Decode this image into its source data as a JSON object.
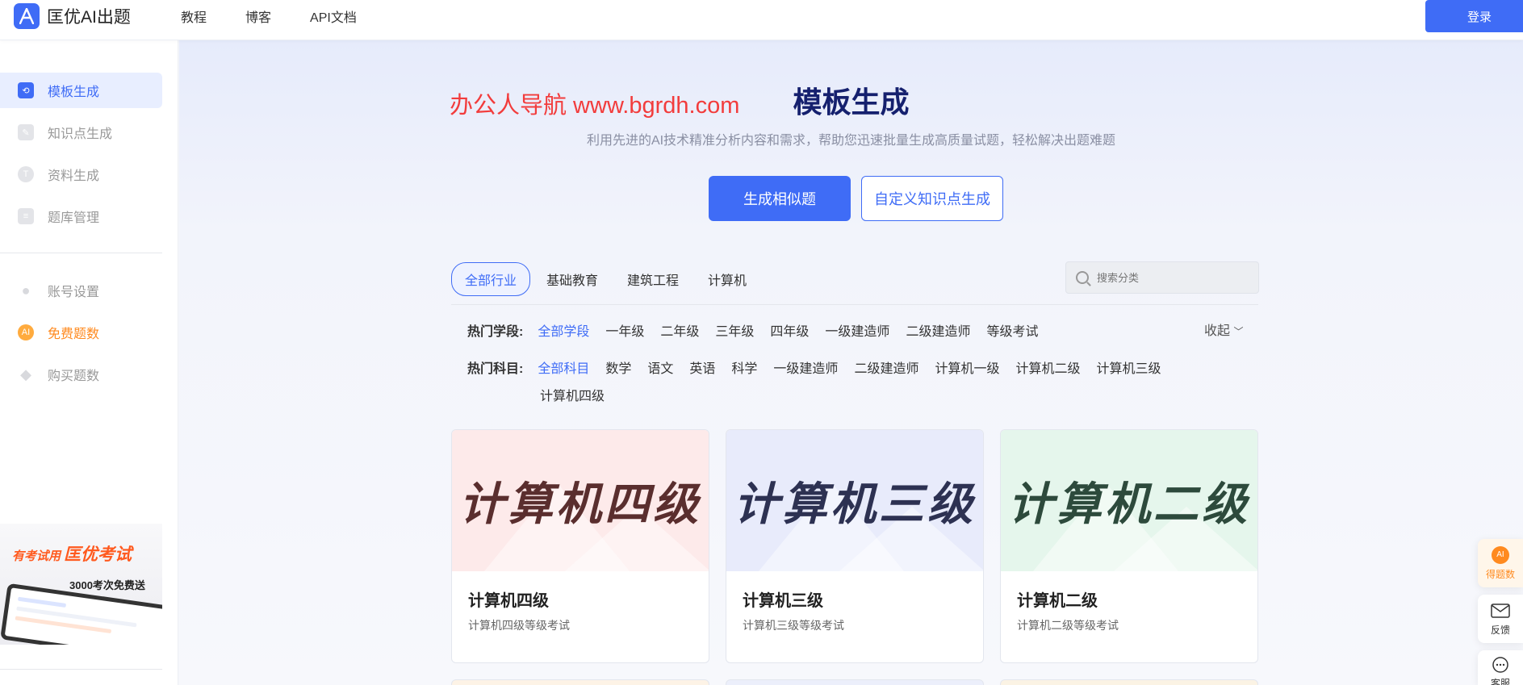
{
  "header": {
    "brand": "匡优AI出题",
    "nav": [
      "教程",
      "博客",
      "API文档"
    ],
    "login_label": "登录"
  },
  "sidebar": {
    "items": [
      {
        "label": "模板生成",
        "icon": "template-icon"
      },
      {
        "label": "知识点生成",
        "icon": "edit-icon"
      },
      {
        "label": "资料生成",
        "icon": "text-icon"
      },
      {
        "label": "题库管理",
        "icon": "database-icon"
      },
      {
        "label": "账号设置",
        "icon": "user-icon"
      },
      {
        "label": "免费题数",
        "icon": "ai-coin-icon"
      },
      {
        "label": "购买题数",
        "icon": "diamond-icon"
      }
    ],
    "promo": {
      "prefix": "有考试用",
      "brand": "匡优考试",
      "sub": "3000考次免费送"
    }
  },
  "main": {
    "watermark": "办公人导航 www.bgrdh.com",
    "title": "模板生成",
    "subtitle": "利用先进的AI技术精准分析内容和需求，帮助您迅速批量生成高质量试题，轻松解决出题难题",
    "btn_similar": "生成相似题",
    "btn_custom": "自定义知识点生成",
    "industry_tabs": [
      "全部行业",
      "基础教育",
      "建筑工程",
      "计算机"
    ],
    "search_placeholder": "搜索分类",
    "stage_label": "热门学段:",
    "stages": [
      "全部学段",
      "一年级",
      "二年级",
      "三年级",
      "四年级",
      "一级建造师",
      "二级建造师",
      "等级考试"
    ],
    "collapse_label": "收起",
    "subject_label": "热门科目:",
    "subjects": [
      "全部科目",
      "数学",
      "语文",
      "英语",
      "科学",
      "一级建造师",
      "二级建造师",
      "计算机一级",
      "计算机二级",
      "计算机三级",
      "计算机四级"
    ],
    "cards": [
      {
        "cover": "计算机四级",
        "title": "计算机四级",
        "desc": "计算机四级等级考试",
        "bg": "#fdeaea",
        "color": "#5a2e2e"
      },
      {
        "cover": "计算机三级",
        "title": "计算机三级",
        "desc": "计算机三级等级考试",
        "bg": "#e8ebfb",
        "color": "#2d3152"
      },
      {
        "cover": "计算机二级",
        "title": "计算机二级",
        "desc": "计算机二级等级考试",
        "bg": "#e5f6ec",
        "color": "#2d4a3c"
      }
    ]
  },
  "float": {
    "get_label": "得题数",
    "feedback_label": "反馈",
    "service_label": "客服"
  }
}
